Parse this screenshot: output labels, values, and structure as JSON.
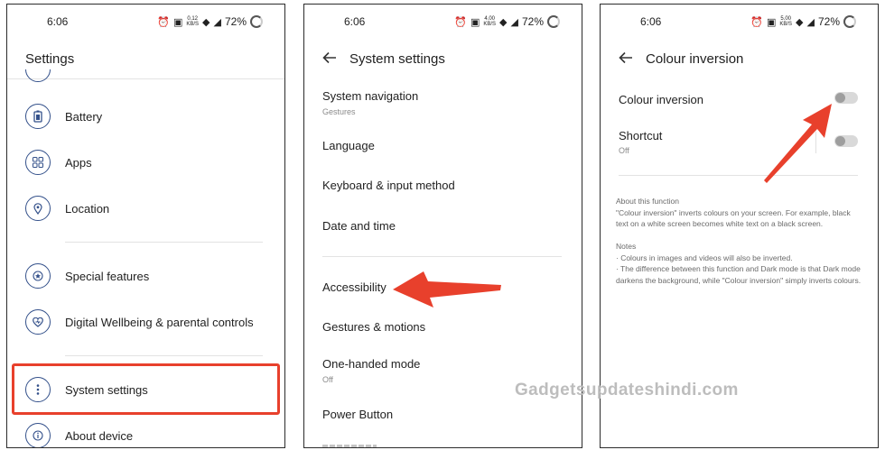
{
  "status_bar": {
    "time": "6:06",
    "battery_percent": "72%",
    "net_speed": [
      "0.12",
      "4.00",
      "5.00"
    ],
    "net_unit": "KB/S"
  },
  "settings_panel": {
    "title": "Settings",
    "items": [
      {
        "label": "Battery",
        "icon": "battery-icon"
      },
      {
        "label": "Apps",
        "icon": "apps-grid-icon"
      },
      {
        "label": "Location",
        "icon": "location-pin-icon"
      },
      {
        "label": "Special features",
        "icon": "star-badge-icon"
      },
      {
        "label": "Digital Wellbeing & parental controls",
        "icon": "heart-icon"
      },
      {
        "label": "System settings",
        "icon": "more-vertical-icon"
      },
      {
        "label": "About device",
        "icon": "info-icon"
      }
    ]
  },
  "system_panel": {
    "title": "System settings",
    "items": [
      {
        "label": "System navigation",
        "sub": "Gestures"
      },
      {
        "label": "Language",
        "sub": ""
      },
      {
        "label": "Keyboard & input method",
        "sub": ""
      },
      {
        "label": "Date and time",
        "sub": ""
      },
      {
        "label": "Accessibility",
        "sub": ""
      },
      {
        "label": "Gestures & motions",
        "sub": ""
      },
      {
        "label": "One-handed mode",
        "sub": "Off"
      },
      {
        "label": "Power Button",
        "sub": ""
      }
    ]
  },
  "colour_panel": {
    "title": "Colour inversion",
    "toggle_label": "Colour inversion",
    "shortcut_label": "Shortcut",
    "shortcut_sub": "Off",
    "about_heading": "About this function",
    "about_text": "\"Colour inversion\" inverts colours on your screen. For example, black text on a white screen becomes white text on a black screen.",
    "notes_heading": "Notes",
    "note_1": "· Colours in images and videos will also be inverted.",
    "note_2": "· The difference between this function and Dark mode is that Dark mode darkens the background, while \"Colour inversion\" simply inverts colours."
  },
  "watermark": "Gadgetsupdateshindi.com",
  "colors": {
    "highlight": "#e8402c",
    "arrow": "#e8402c",
    "icon_stroke": "#33508a"
  }
}
